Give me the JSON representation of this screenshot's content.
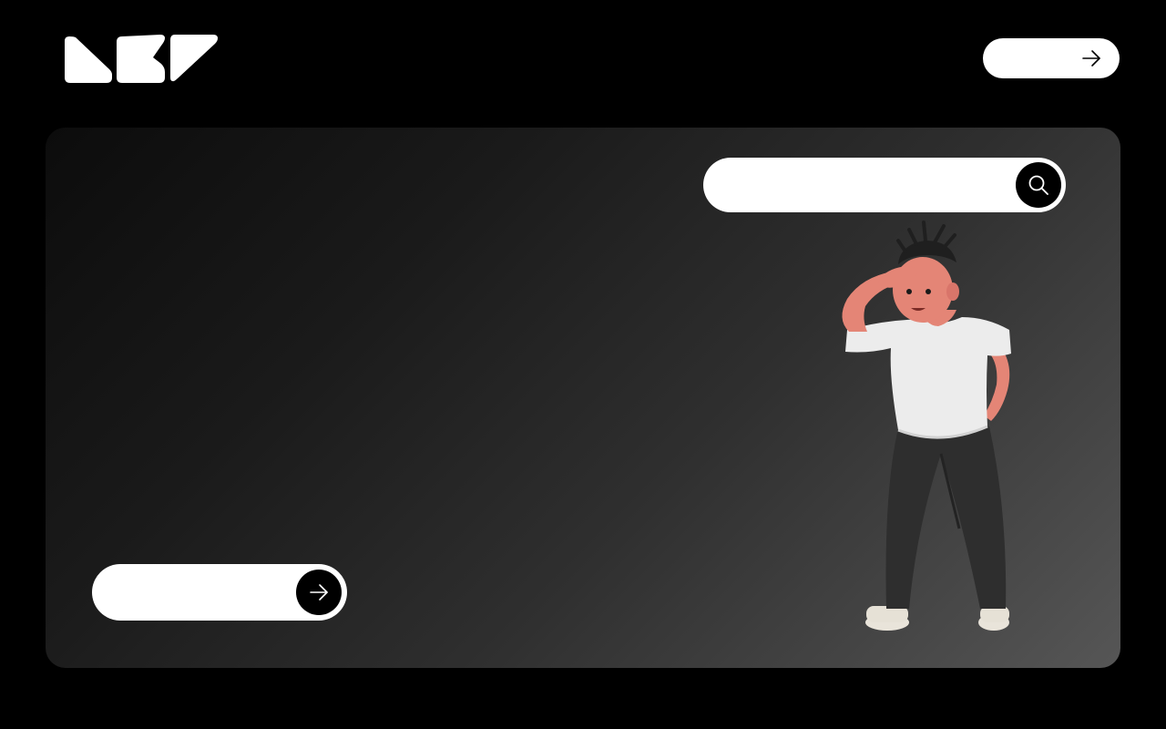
{
  "header": {
    "logo_icon": "brand-logo-shapes",
    "cta": {
      "label": "",
      "icon": "arrow-right-icon"
    }
  },
  "hero": {
    "search": {
      "placeholder": "",
      "value": "",
      "icon": "search-icon"
    },
    "illustration": "3d-character-looking-out",
    "cta": {
      "label": "",
      "icon": "arrow-right-icon"
    }
  },
  "colors": {
    "background": "#000000",
    "panel_dark": "#0c0c0c",
    "panel_light": "#565656",
    "pill": "#ffffff",
    "accent": "#000000"
  }
}
